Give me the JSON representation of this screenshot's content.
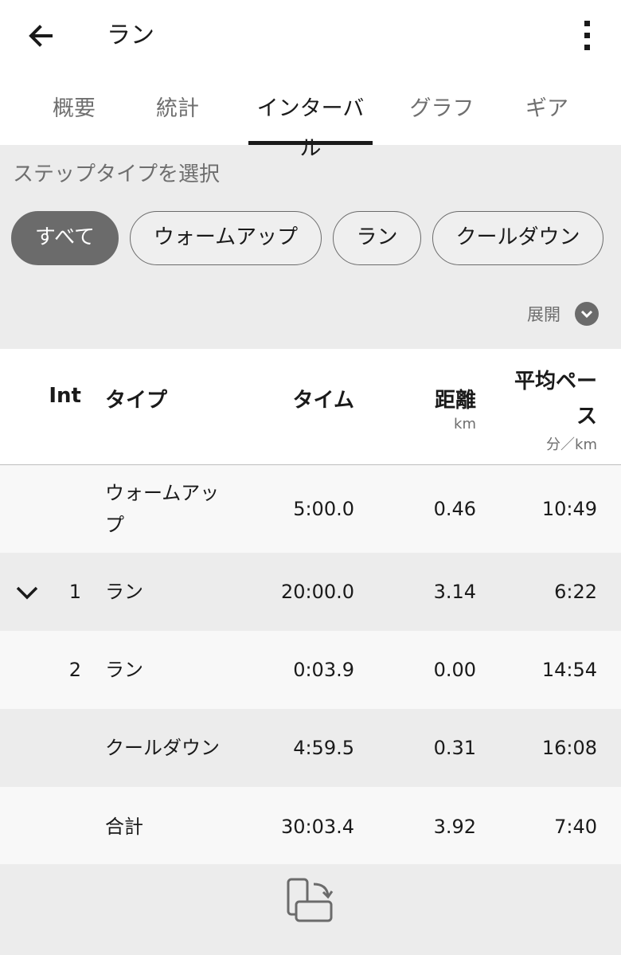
{
  "appbar": {
    "title": "ラン",
    "back_icon": "arrow-left-icon",
    "menu_icon": "more-vertical-icon"
  },
  "tabs": [
    {
      "label": "概要",
      "active": false
    },
    {
      "label": "統計",
      "active": false
    },
    {
      "label": "インターバル",
      "active": true
    },
    {
      "label": "グラフ",
      "active": false
    },
    {
      "label": "ギア",
      "active": false
    }
  ],
  "filter": {
    "label": "ステップタイプを選択",
    "chips": [
      {
        "label": "すべて",
        "selected": true
      },
      {
        "label": "ウォームアップ",
        "selected": false
      },
      {
        "label": "ラン",
        "selected": false
      },
      {
        "label": "クールダウン",
        "selected": false
      }
    ],
    "expand_label": "展開"
  },
  "table": {
    "headers": {
      "int": "Int",
      "type": "タイプ",
      "time": "タイム",
      "distance": "距離",
      "distance_unit": "km",
      "pace_line1": "平均ペー",
      "pace_line2": "ス",
      "pace_unit": "分／km"
    },
    "rows": [
      {
        "int": "",
        "type_line1": "ウォームアッ",
        "type_line2": "プ",
        "time": "5:00.0",
        "distance": "0.46",
        "pace": "10:49",
        "expandable": false
      },
      {
        "int": "1",
        "type_line1": "ラン",
        "type_line2": "",
        "time": "20:00.0",
        "distance": "3.14",
        "pace": "6:22",
        "expandable": true
      },
      {
        "int": "2",
        "type_line1": "ラン",
        "type_line2": "",
        "time": "0:03.9",
        "distance": "0.00",
        "pace": "14:54",
        "expandable": false
      },
      {
        "int": "",
        "type_line1": "クールダウン",
        "type_line2": "",
        "time": "4:59.5",
        "distance": "0.31",
        "pace": "16:08",
        "expandable": false
      },
      {
        "int": "",
        "type_line1": "合計",
        "type_line2": "",
        "time": "30:03.4",
        "distance": "3.92",
        "pace": "7:40",
        "expandable": false
      }
    ]
  },
  "bottom": {
    "rotate_icon": "screen-rotate-icon"
  },
  "colors": {
    "accent": "#1a1a1a",
    "chip_selected": "#6b6b6b",
    "panel": "#ececec"
  }
}
